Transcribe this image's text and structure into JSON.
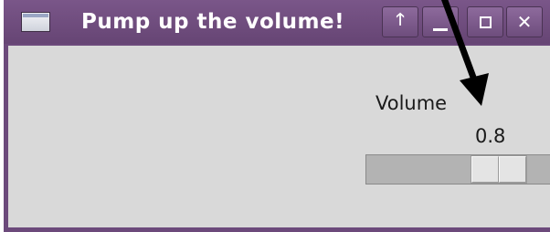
{
  "window": {
    "title": "Pump up the volume!",
    "title_color": "#ffffff",
    "frame_color": "#6c4a7b",
    "buttons": {
      "raise_icon": "up-arrow-icon",
      "raise_glyph": "🡑",
      "minimize_icon": "minimize-icon",
      "maximize_icon": "maximize-icon",
      "close_icon": "close-icon",
      "close_glyph": "✕"
    }
  },
  "volume": {
    "label": "Volume",
    "value_text": "0.8",
    "value": 0.8,
    "min": 0,
    "max": 1
  },
  "annotation": {
    "arrow_color": "#000000"
  }
}
